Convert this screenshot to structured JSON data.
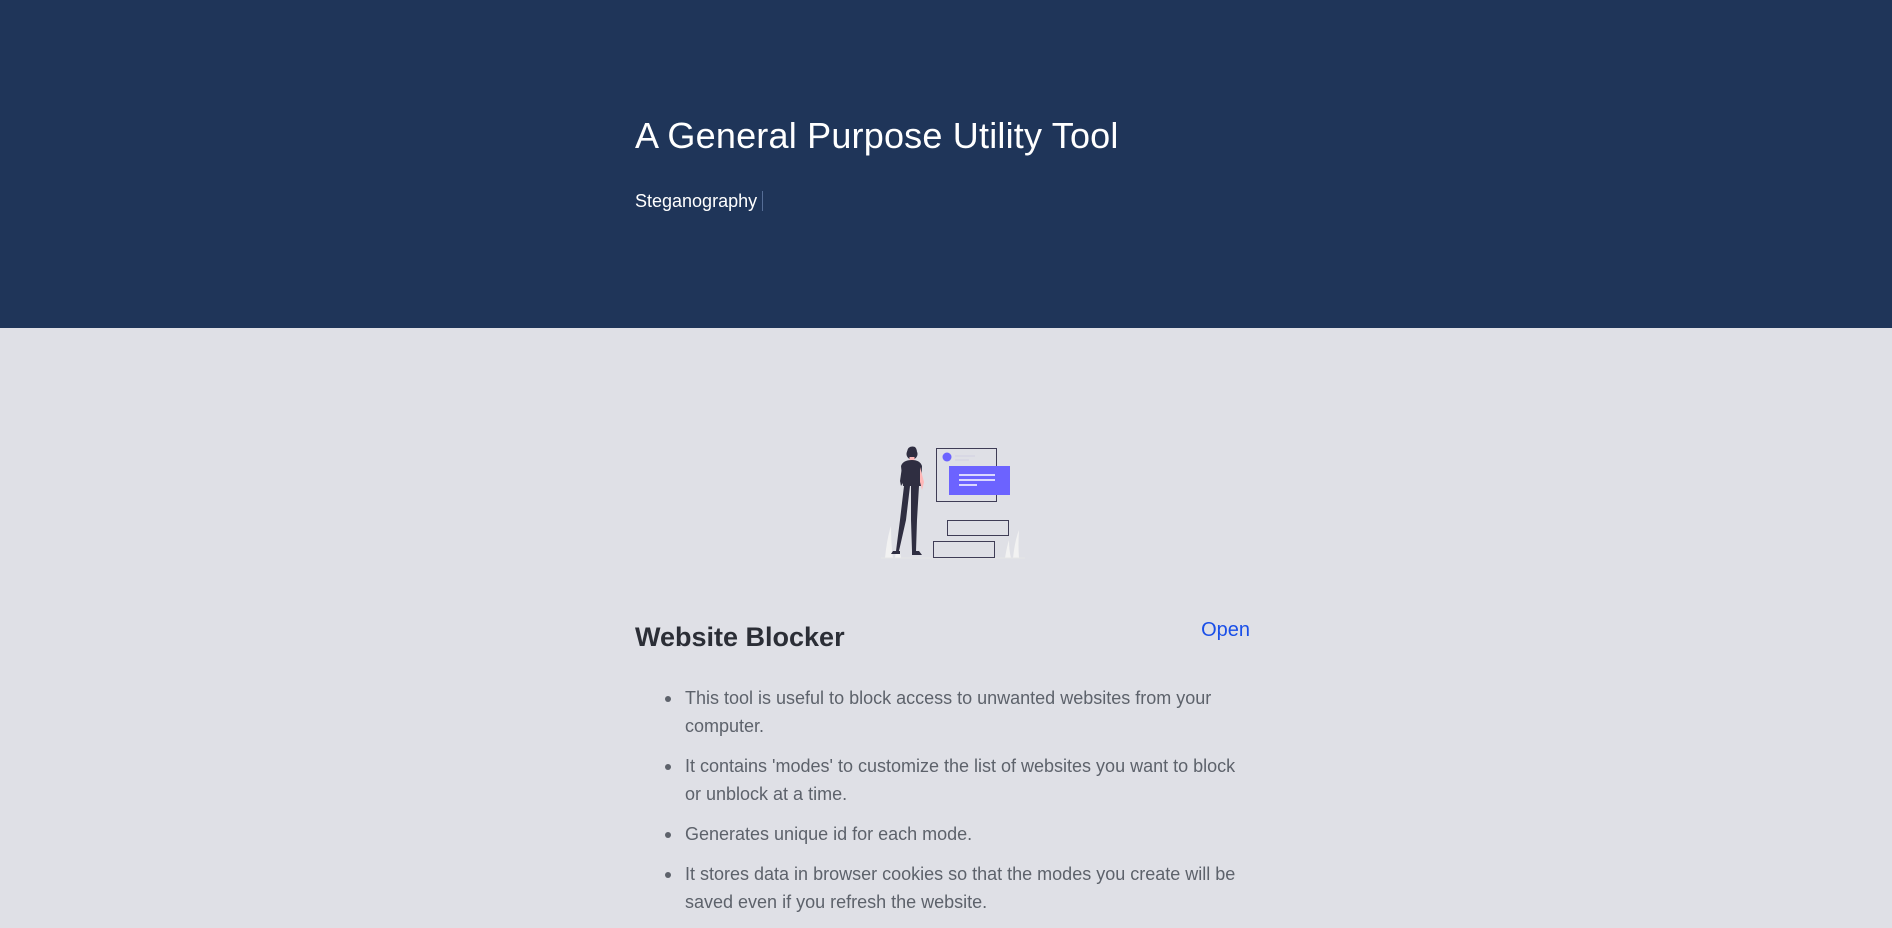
{
  "hero": {
    "title": "A General Purpose Utility Tool",
    "typed_text": "Steganography"
  },
  "card": {
    "illustration_icon": "person-viewing-screens-illustration",
    "title": "Website Blocker",
    "open_label": "Open",
    "features": [
      "This tool is useful to block access to unwanted websites from your computer.",
      "It contains 'modes' to customize the list of websites you want to block or unblock at a time.",
      "Generates unique id for each mode.",
      "It stores data in browser cookies so that the modes you create will be saved even if you refresh the website."
    ]
  },
  "colors": {
    "hero_bg": "#1f3559",
    "page_bg": "#dfe0e6",
    "accent": "#6c63ff",
    "link": "#1a4fe8"
  }
}
